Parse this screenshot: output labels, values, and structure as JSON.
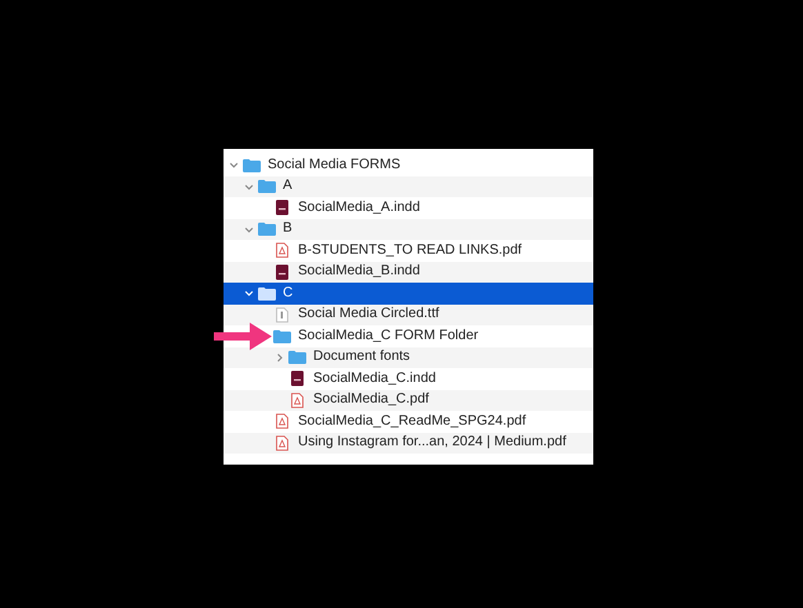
{
  "tree": [
    {
      "kind": "folder",
      "name": "Social Media FORMS",
      "expanded": true,
      "selected": false,
      "children": [
        {
          "kind": "folder",
          "name": "A",
          "expanded": true,
          "selected": false,
          "children": [
            {
              "kind": "indd",
              "name": "SocialMedia_A.indd",
              "selected": false
            }
          ]
        },
        {
          "kind": "folder",
          "name": "B",
          "expanded": true,
          "selected": false,
          "children": [
            {
              "kind": "pdf",
              "name": "B-STUDENTS_TO READ LINKS.pdf",
              "selected": false
            },
            {
              "kind": "indd",
              "name": "SocialMedia_B.indd",
              "selected": false
            }
          ]
        },
        {
          "kind": "folder",
          "name": "C",
          "expanded": true,
          "selected": true,
          "children": [
            {
              "kind": "font",
              "name": "Social Media Circled.ttf",
              "selected": false
            },
            {
              "kind": "folder",
              "name": "SocialMedia_C FORM Folder",
              "selected": false,
              "children": [
                {
                  "kind": "folder",
                  "name": "Document fonts",
                  "expanded": false,
                  "selected": false
                },
                {
                  "kind": "indd",
                  "name": "SocialMedia_C.indd",
                  "selected": false
                },
                {
                  "kind": "pdf",
                  "name": "SocialMedia_C.pdf",
                  "selected": false
                }
              ]
            },
            {
              "kind": "pdf",
              "name": "SocialMedia_C_ReadMe_SPG24.pdf",
              "selected": false
            },
            {
              "kind": "pdf",
              "name": "Using Instagram for...an, 2024 | Medium.pdf",
              "selected": false
            }
          ]
        }
      ]
    }
  ]
}
